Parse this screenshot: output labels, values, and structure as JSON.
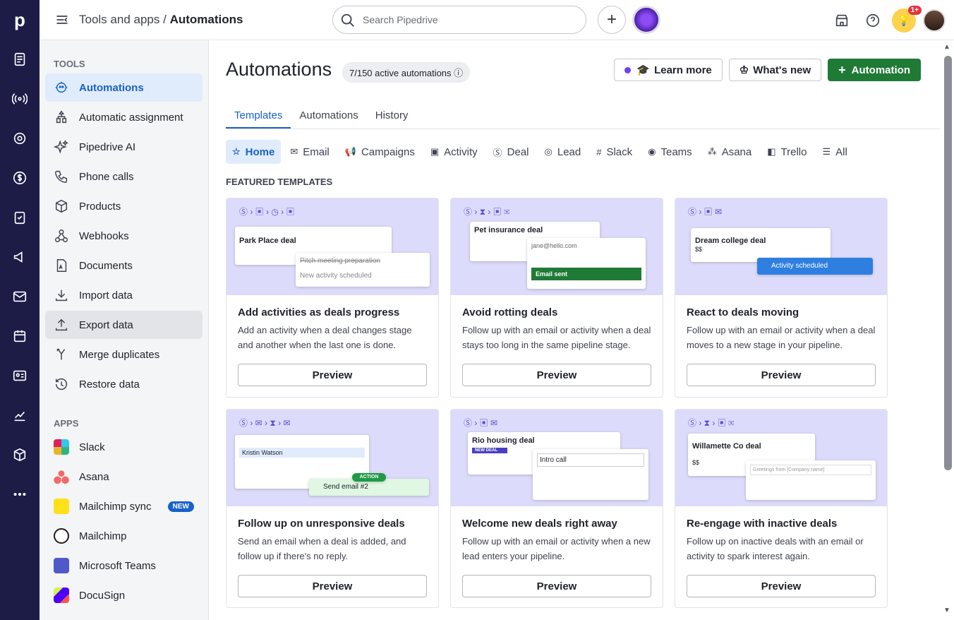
{
  "header": {
    "crumb_parent": "Tools and apps",
    "crumb_sep": "/",
    "crumb_current": "Automations",
    "search_placeholder": "Search Pipedrive",
    "badge": "1+"
  },
  "sidebar": {
    "tools_heading": "TOOLS",
    "tools": [
      "Automations",
      "Automatic assignment",
      "Pipedrive AI",
      "Phone calls",
      "Products",
      "Webhooks",
      "Documents",
      "Import data",
      "Export data",
      "Merge duplicates",
      "Restore data"
    ],
    "apps_heading": "APPS",
    "apps": [
      "Slack",
      "Asana",
      "Mailchimp sync",
      "Mailchimp",
      "Microsoft Teams",
      "DocuSign"
    ],
    "new_badge": "NEW"
  },
  "main": {
    "title": "Automations",
    "count": "7/150 active automations",
    "learn_more": "Learn more",
    "whats_new": "What's new",
    "add_automation": "Automation",
    "tabs": [
      "Templates",
      "Automations",
      "History"
    ],
    "categories": [
      "Home",
      "Email",
      "Campaigns",
      "Activity",
      "Deal",
      "Lead",
      "Slack",
      "Teams",
      "Asana",
      "Trello",
      "All"
    ],
    "featured": "FEATURED TEMPLATES",
    "cards": [
      {
        "title": "Add activities as deals progress",
        "desc": "Add an activity when a deal changes stage and another when the last one is done.",
        "mini1": "Park Place deal",
        "mini2": "Pitch meeting preparation",
        "mini3": "New activity scheduled"
      },
      {
        "title": "Avoid rotting deals",
        "desc": "Follow up with an email or activity when a deal stays too long in the same pipeline stage.",
        "mini1": "Pet insurance deal",
        "mini2": "jane@hello.com",
        "mini3": "Email sent"
      },
      {
        "title": "React to deals moving",
        "desc": "Follow up with an email or activity when a deal moves to a new stage in your pipeline.",
        "mini1": "Dream college deal",
        "mini2": "Activity scheduled",
        "mini3": "$$"
      },
      {
        "title": "Follow up on unresponsive deals",
        "desc": "Send an email when a deal is added, and follow up if there's no reply.",
        "mini1": "Kristin Watson",
        "mini2": "Send email #2",
        "mini3": "ACTION"
      },
      {
        "title": "Welcome new deals right away",
        "desc": "Follow up with an email or activity when a new lead enters your pipeline.",
        "mini1": "Rio housing deal",
        "mini2": "Intro call",
        "mini3": "NEW DEAL"
      },
      {
        "title": "Re-engage with inactive deals",
        "desc": "Follow up on inactive deals with an email or activity to spark interest again.",
        "mini1": "Willamette Co deal",
        "mini2": "Greetings from [Company name]",
        "mini3": "$$"
      }
    ],
    "preview": "Preview"
  }
}
